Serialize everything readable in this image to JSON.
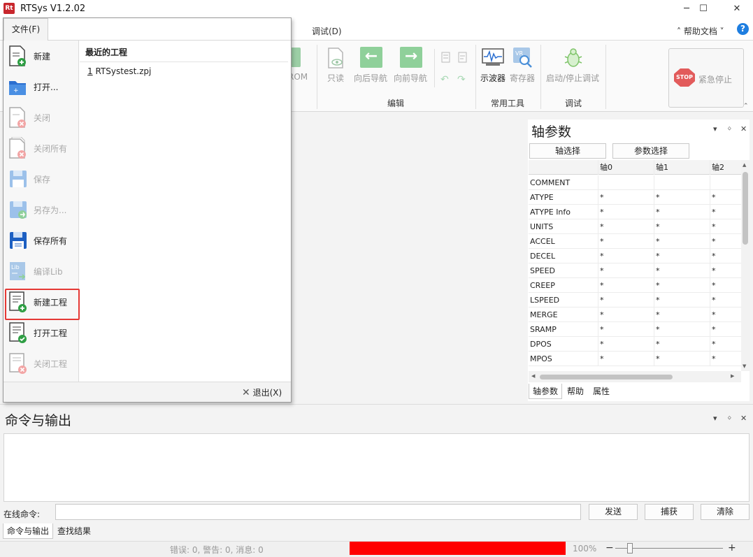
{
  "window": {
    "title": "RTSys V1.2.02",
    "icon_text": "Rt",
    "controls": {
      "minimize": "─",
      "maximize": "☐",
      "close": "✕"
    }
  },
  "menubar": {
    "debug_menu": "调试(D)",
    "help_doc": "˄ 帮助文档 ˅",
    "help_icon": "?"
  },
  "ribbon": {
    "rom_label": "ROM",
    "readonly_label": "只读",
    "nav_back_label": "向后导航",
    "nav_forward_label": "向前导航",
    "oscilloscope_label": "示波器",
    "register_label": "寄存器",
    "debug_toggle_label": "启动/停止调试",
    "groups": {
      "edit": "编辑",
      "tools": "常用工具",
      "debug": "调试"
    },
    "estop": {
      "icon_text": "STOP",
      "label": "紧急停止"
    }
  },
  "axis_panel": {
    "title": "轴参数",
    "controls": {
      "dropdown": "▾",
      "pin": "ᛜ",
      "close": "✕"
    },
    "axis_select_btn": "轴选择",
    "param_select_btn": "参数选择",
    "columns": [
      "",
      "轴0",
      "轴1",
      "轴2"
    ],
    "rows": [
      {
        "name": "COMMENT",
        "v": [
          "",
          "",
          ""
        ]
      },
      {
        "name": "ATYPE",
        "v": [
          "*",
          "*",
          "*"
        ]
      },
      {
        "name": "ATYPE Info",
        "v": [
          "*",
          "*",
          "*"
        ]
      },
      {
        "name": "UNITS",
        "v": [
          "*",
          "*",
          "*"
        ]
      },
      {
        "name": "ACCEL",
        "v": [
          "*",
          "*",
          "*"
        ]
      },
      {
        "name": "DECEL",
        "v": [
          "*",
          "*",
          "*"
        ]
      },
      {
        "name": "SPEED",
        "v": [
          "*",
          "*",
          "*"
        ]
      },
      {
        "name": "CREEP",
        "v": [
          "*",
          "*",
          "*"
        ]
      },
      {
        "name": "LSPEED",
        "v": [
          "*",
          "*",
          "*"
        ]
      },
      {
        "name": "MERGE",
        "v": [
          "*",
          "*",
          "*"
        ]
      },
      {
        "name": "SRAMP",
        "v": [
          "*",
          "*",
          "*"
        ]
      },
      {
        "name": "DPOS",
        "v": [
          "*",
          "*",
          "*"
        ]
      },
      {
        "name": "MPOS",
        "v": [
          "*",
          "*",
          "*"
        ]
      }
    ],
    "tabs": [
      "轴参数",
      "帮助",
      "属性"
    ]
  },
  "command_panel": {
    "title": "命令与输出",
    "online_label": "在线命令:",
    "send_btn": "发送",
    "capture_btn": "捕获",
    "clear_btn": "清除",
    "tabs": [
      "命令与输出",
      "查找结果"
    ]
  },
  "statusbar": {
    "message": "错误: 0, 警告: 0, 消息: 0",
    "progress_fraction": 1.0,
    "progress_color": "#ff0000",
    "zoom": "100%",
    "zoom_minus": "−",
    "zoom_plus": "+"
  },
  "file_menu": {
    "tab_label": "文件(F)",
    "items": [
      {
        "label": "新建",
        "icon": "new-file-icon",
        "enabled": true
      },
      {
        "label": "打开...",
        "icon": "open-folder-icon",
        "enabled": true
      },
      {
        "label": "关闭",
        "icon": "close-file-icon",
        "enabled": false
      },
      {
        "label": "关闭所有",
        "icon": "close-all-icon",
        "enabled": false
      },
      {
        "label": "保存",
        "icon": "save-icon",
        "enabled": false
      },
      {
        "label": "另存为...",
        "icon": "save-as-icon",
        "enabled": false
      },
      {
        "label": "保存所有",
        "icon": "save-all-icon",
        "enabled": true
      },
      {
        "label": "编译Lib",
        "icon": "compile-lib-icon",
        "enabled": false
      },
      {
        "label": "新建工程",
        "icon": "new-project-icon",
        "enabled": true,
        "highlighted": true
      },
      {
        "label": "打开工程",
        "icon": "open-project-icon",
        "enabled": true
      },
      {
        "label": "关闭工程",
        "icon": "close-project-icon",
        "enabled": false
      }
    ],
    "recent_header": "最近的工程",
    "recent_projects": [
      {
        "index": "1",
        "name": "RTSystest.zpj"
      }
    ],
    "exit_label": "退出(X)"
  },
  "colors": {
    "highlight_border": "#e53935",
    "accent_blue": "#1e7ee0",
    "icon_green": "#2f9e44",
    "icon_blue": "#2b6fd1"
  }
}
